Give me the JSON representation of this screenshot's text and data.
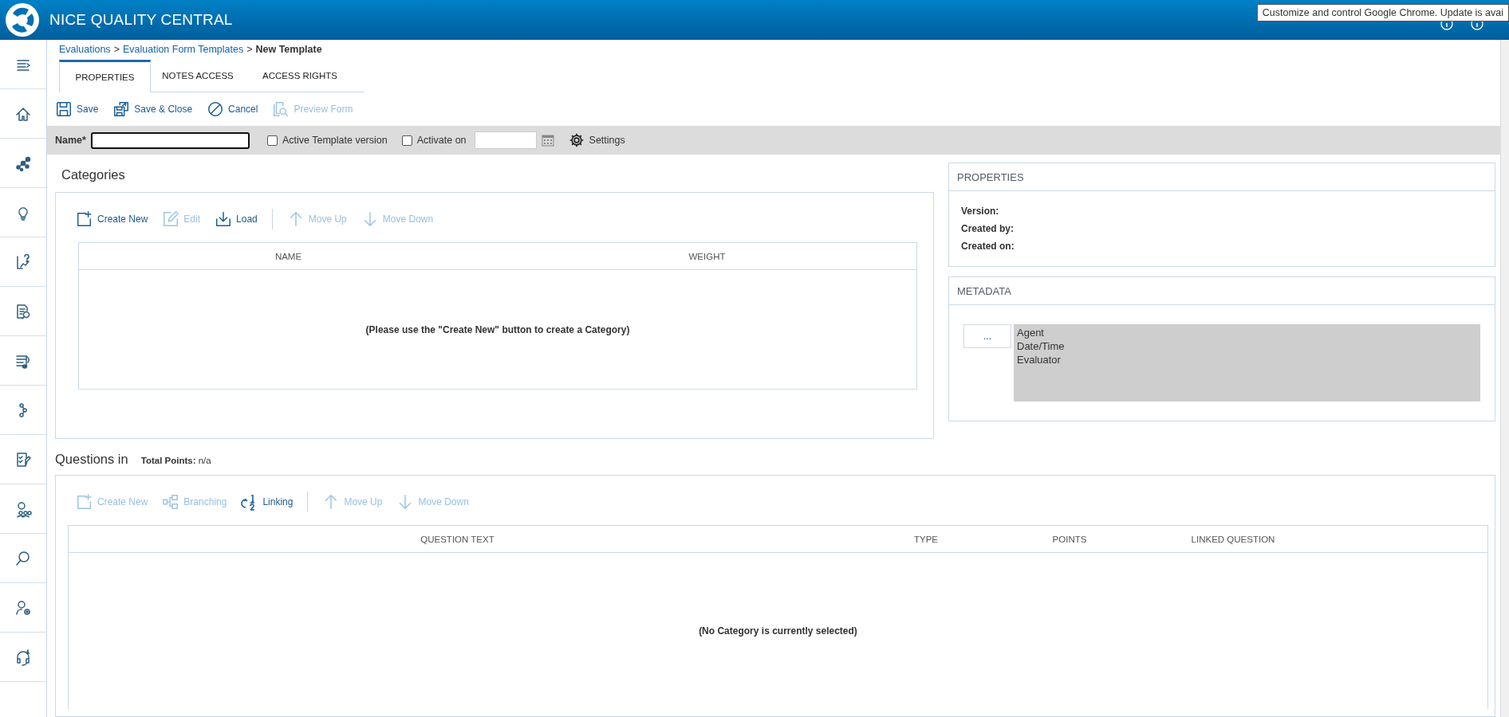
{
  "header": {
    "title": "NICE QUALITY CENTRAL",
    "tooltip": "Customize and control Google Chrome. Update is avai"
  },
  "breadcrumb": {
    "separator": ">",
    "items": [
      {
        "label": "Evaluations",
        "kind": "link"
      },
      {
        "label": "Evaluation Form Templates",
        "kind": "link"
      },
      {
        "label": "New Template",
        "kind": "current"
      }
    ]
  },
  "tabs": [
    {
      "label": "PROPERTIES",
      "selected": true
    },
    {
      "label": "NOTES ACCESS",
      "selected": false
    },
    {
      "label": "ACCESS RIGHTS",
      "selected": false
    }
  ],
  "toolbar": [
    {
      "label": "Save",
      "kind": "save",
      "disabled": false
    },
    {
      "label": "Save & Close",
      "kind": "save-close",
      "disabled": false
    },
    {
      "label": "Cancel",
      "kind": "cancel",
      "disabled": false
    },
    {
      "label": "Preview Form",
      "kind": "preview",
      "disabled": true
    }
  ],
  "name_bar": {
    "name_label": "Name*",
    "active_template": {
      "label": "Active Template version",
      "checked": false
    },
    "activate_on": {
      "label": "Activate on",
      "checked": false
    },
    "settings": "Settings"
  },
  "categories": {
    "title": "Categories",
    "toolbar": [
      {
        "label": "Create New",
        "kind": "create",
        "disabled": false
      },
      {
        "label": "Edit",
        "kind": "edit",
        "disabled": true
      },
      {
        "label": "Load",
        "kind": "load",
        "disabled": false
      },
      {
        "label": "Move Up",
        "kind": "up",
        "disabled": true
      },
      {
        "label": "Move Down",
        "kind": "down",
        "disabled": true
      }
    ],
    "columns": [
      "NAME",
      "WEIGHT"
    ],
    "empty_message": "(Please use the \"Create New\" button to create a Category)"
  },
  "properties": {
    "title": "PROPERTIES",
    "fields": [
      "Version:",
      "Created by:",
      "Created on:"
    ]
  },
  "metadata": {
    "title": "METADATA",
    "button": "...",
    "items": [
      "Agent",
      "Date/Time",
      "Evaluator"
    ]
  },
  "questions": {
    "title": "Questions in",
    "total_label": "Total Points:",
    "total_value": "n/a",
    "toolbar": [
      {
        "label": "Create New",
        "kind": "create",
        "disabled": true
      },
      {
        "label": "Branching",
        "kind": "branching",
        "disabled": true
      },
      {
        "label": "Linking",
        "kind": "linking",
        "disabled": false
      },
      {
        "label": "Move Up",
        "kind": "up",
        "disabled": true
      },
      {
        "label": "Move Down",
        "kind": "down",
        "disabled": true
      }
    ],
    "columns": [
      "QUESTION TEXT",
      "TYPE",
      "POINTS",
      "LINKED QUESTION"
    ],
    "empty_message": "(No Category is currently selected)"
  }
}
